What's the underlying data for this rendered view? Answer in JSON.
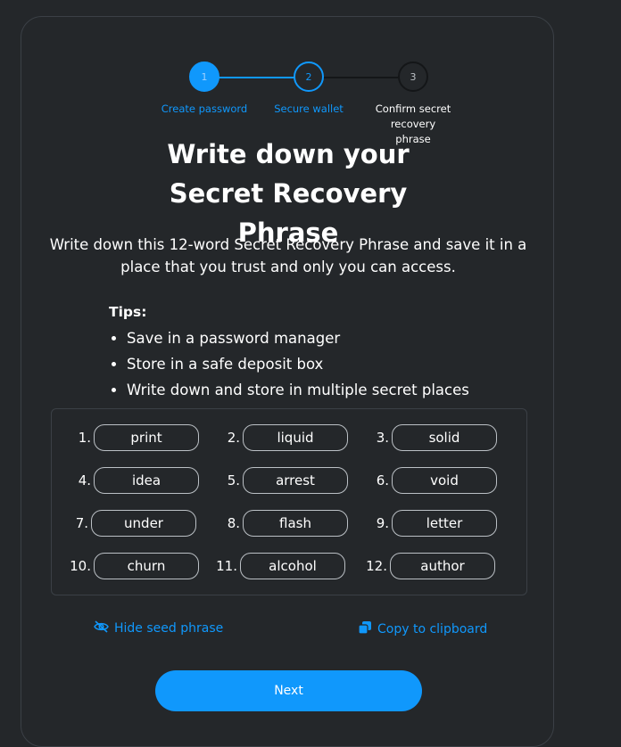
{
  "stepper": {
    "steps": [
      {
        "number": "1",
        "label": "Create password"
      },
      {
        "number": "2",
        "label": "Secure wallet"
      },
      {
        "number": "3",
        "label": "Confirm secret recovery phrase"
      }
    ]
  },
  "title": "Write down your Secret Recovery Phrase",
  "description": "Write down this 12-word Secret Recovery Phrase and save it in a place that you trust and only you can access.",
  "tips": {
    "title": "Tips:",
    "items": [
      "Save in a password manager",
      "Store in a safe deposit box",
      "Write down and store in multiple secret places"
    ]
  },
  "phrase": [
    {
      "num": "1.",
      "word": "print"
    },
    {
      "num": "2.",
      "word": "liquid"
    },
    {
      "num": "3.",
      "word": "solid"
    },
    {
      "num": "4.",
      "word": "idea"
    },
    {
      "num": "5.",
      "word": "arrest"
    },
    {
      "num": "6.",
      "word": "void"
    },
    {
      "num": "7.",
      "word": "under"
    },
    {
      "num": "8.",
      "word": "flash"
    },
    {
      "num": "9.",
      "word": "letter"
    },
    {
      "num": "10.",
      "word": "churn"
    },
    {
      "num": "11.",
      "word": "alcohol"
    },
    {
      "num": "12.",
      "word": "author"
    }
  ],
  "actions": {
    "hide_label": "Hide seed phrase",
    "copy_label": "Copy to clipboard"
  },
  "next_label": "Next",
  "colors": {
    "accent": "#1098fc",
    "background": "#24272a",
    "border": "#3b4046"
  }
}
